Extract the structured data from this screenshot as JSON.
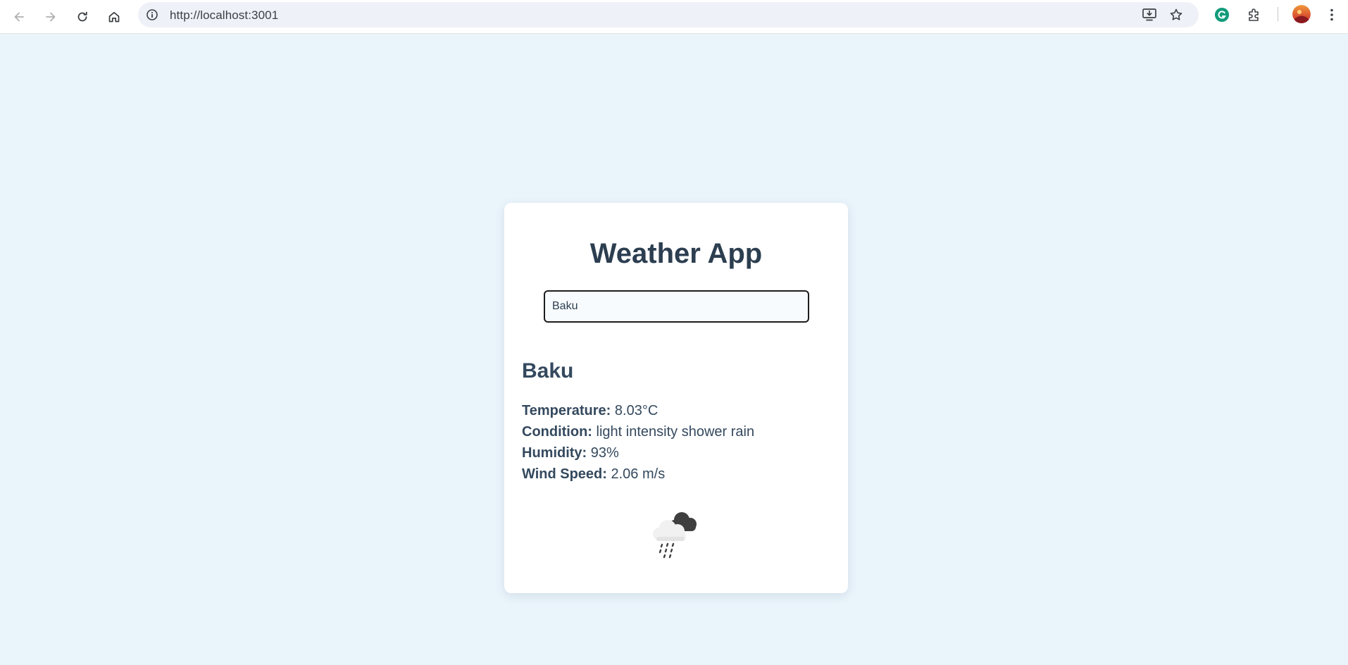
{
  "browser": {
    "url": "http://localhost:3001",
    "icons": [
      "back-icon",
      "forward-icon",
      "reload-icon",
      "home-icon",
      "site-info-icon",
      "install-icon",
      "bookmark-star-icon",
      "grammarly-icon",
      "extensions-icon",
      "profile-avatar",
      "more-menu-icon"
    ]
  },
  "app": {
    "title": "Weather App",
    "search": {
      "value": "Baku",
      "placeholder": ""
    },
    "weather": {
      "city": "Baku",
      "temperature_label": "Temperature:",
      "temperature_value": "8.03°C",
      "condition_label": "Condition:",
      "condition_value": "light intensity shower rain",
      "humidity_label": "Humidity:",
      "humidity_value": "93%",
      "wind_label": "Wind Speed:",
      "wind_value": "2.06 m/s",
      "icon": "shower-rain-cloud-icon"
    }
  },
  "colors": {
    "page_background": "#eaf4fb",
    "card_background": "#ffffff",
    "title_text": "#2c3e50",
    "body_text": "#34495e"
  }
}
